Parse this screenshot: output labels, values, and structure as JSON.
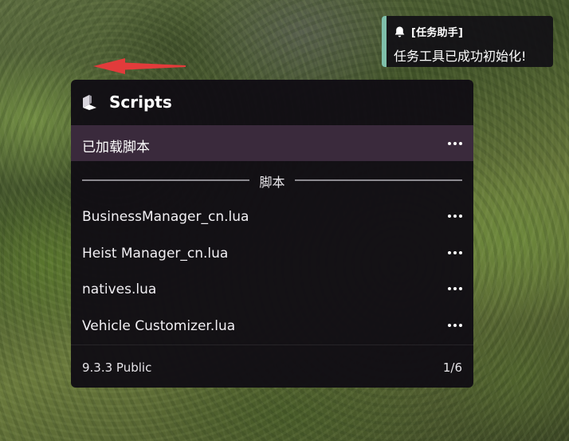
{
  "notification": {
    "title": "[任务助手]",
    "message": "任务工具已成功初始化!",
    "accent_color": "#7fbfaa",
    "icon": "bell-icon"
  },
  "panel": {
    "title": "Scripts",
    "logo_icon": "menu-logo-icon",
    "loaded_item": {
      "label": "已加载脚本",
      "highlight_color": "#3a2a3c",
      "annotation": "red-arrow-pointer"
    },
    "section_label": "脚本",
    "scripts": [
      {
        "name": "BusinessManager_cn.lua"
      },
      {
        "name": "Heist Manager_cn.lua"
      },
      {
        "name": "natives.lua"
      },
      {
        "name": "Vehicle Customizer.lua"
      }
    ],
    "footer": {
      "version": "9.3.3 Public",
      "page_count": "1/6"
    },
    "more_icon": "more-options-icon"
  }
}
